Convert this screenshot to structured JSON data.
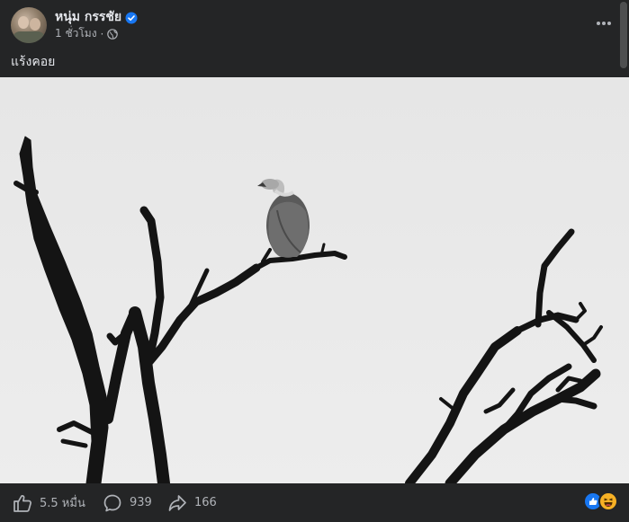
{
  "post": {
    "author": "หนุ่ม กรรชัย",
    "time": "1 ชั่วโมง",
    "separator": "·",
    "caption": "แร้งคอย",
    "more_icon": "more-horizontal-icon",
    "verified_icon": "verified-badge-icon",
    "audience_icon": "globe-icon"
  },
  "photo": {
    "description_icon": "vulture-on-dead-tree-photo"
  },
  "footer": {
    "like_count": "5.5 หมื่น",
    "comment_count": "939",
    "share_count": "166"
  },
  "colors": {
    "background": "#242526",
    "text_primary": "#e4e6eb",
    "text_secondary": "#b0b3b8",
    "verified": "#1877f2",
    "like_reaction": "#1877f2",
    "haha_reaction": "#f7b125"
  }
}
